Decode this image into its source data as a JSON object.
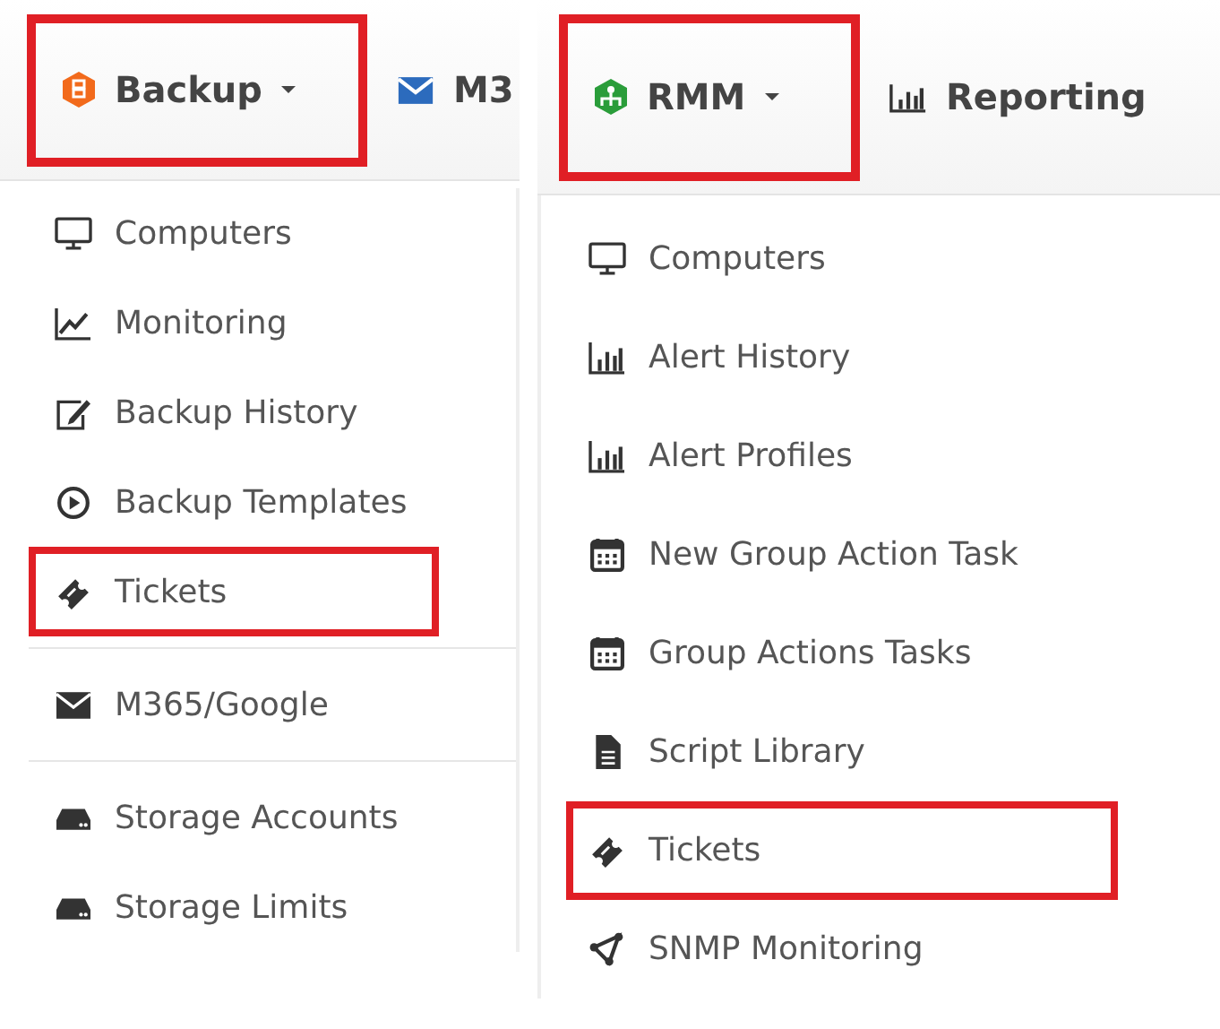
{
  "panels": [
    {
      "menu": {
        "label": "Backup",
        "kind": "backup",
        "highlighted": true
      },
      "next_menu": {
        "label": "M3",
        "kind": "envelope"
      },
      "groups": [
        [
          {
            "label": "Computers",
            "kind": "monitor",
            "highlighted": false
          },
          {
            "label": "Monitoring",
            "kind": "line-chart",
            "highlighted": false
          },
          {
            "label": "Backup History",
            "kind": "edit",
            "highlighted": false
          },
          {
            "label": "Backup Templates",
            "kind": "play",
            "highlighted": false
          },
          {
            "label": "Tickets",
            "kind": "ticket",
            "highlighted": true
          }
        ],
        [
          {
            "label": "M365/Google",
            "kind": "envelope",
            "highlighted": false
          }
        ],
        [
          {
            "label": "Storage Accounts",
            "kind": "drive",
            "highlighted": false
          },
          {
            "label": "Storage Limits",
            "kind": "drive",
            "highlighted": false
          }
        ]
      ]
    },
    {
      "menu": {
        "label": "RMM",
        "kind": "rmm",
        "highlighted": true
      },
      "next_menu": {
        "label": "Reporting",
        "kind": "bar-chart"
      },
      "groups": [
        [
          {
            "label": "Computers",
            "kind": "monitor",
            "highlighted": false
          },
          {
            "label": "Alert History",
            "kind": "bar-chart",
            "highlighted": false
          },
          {
            "label": "Alert Profiles",
            "kind": "bar-chart",
            "highlighted": false
          },
          {
            "label": "New Group Action Task",
            "kind": "calendar",
            "highlighted": false
          },
          {
            "label": "Group Actions Tasks",
            "kind": "calendar",
            "highlighted": false
          },
          {
            "label": "Script Library",
            "kind": "file",
            "highlighted": false
          },
          {
            "label": "Tickets",
            "kind": "ticket",
            "highlighted": true
          },
          {
            "label": "SNMP Monitoring",
            "kind": "share",
            "highlighted": false
          }
        ]
      ]
    }
  ]
}
